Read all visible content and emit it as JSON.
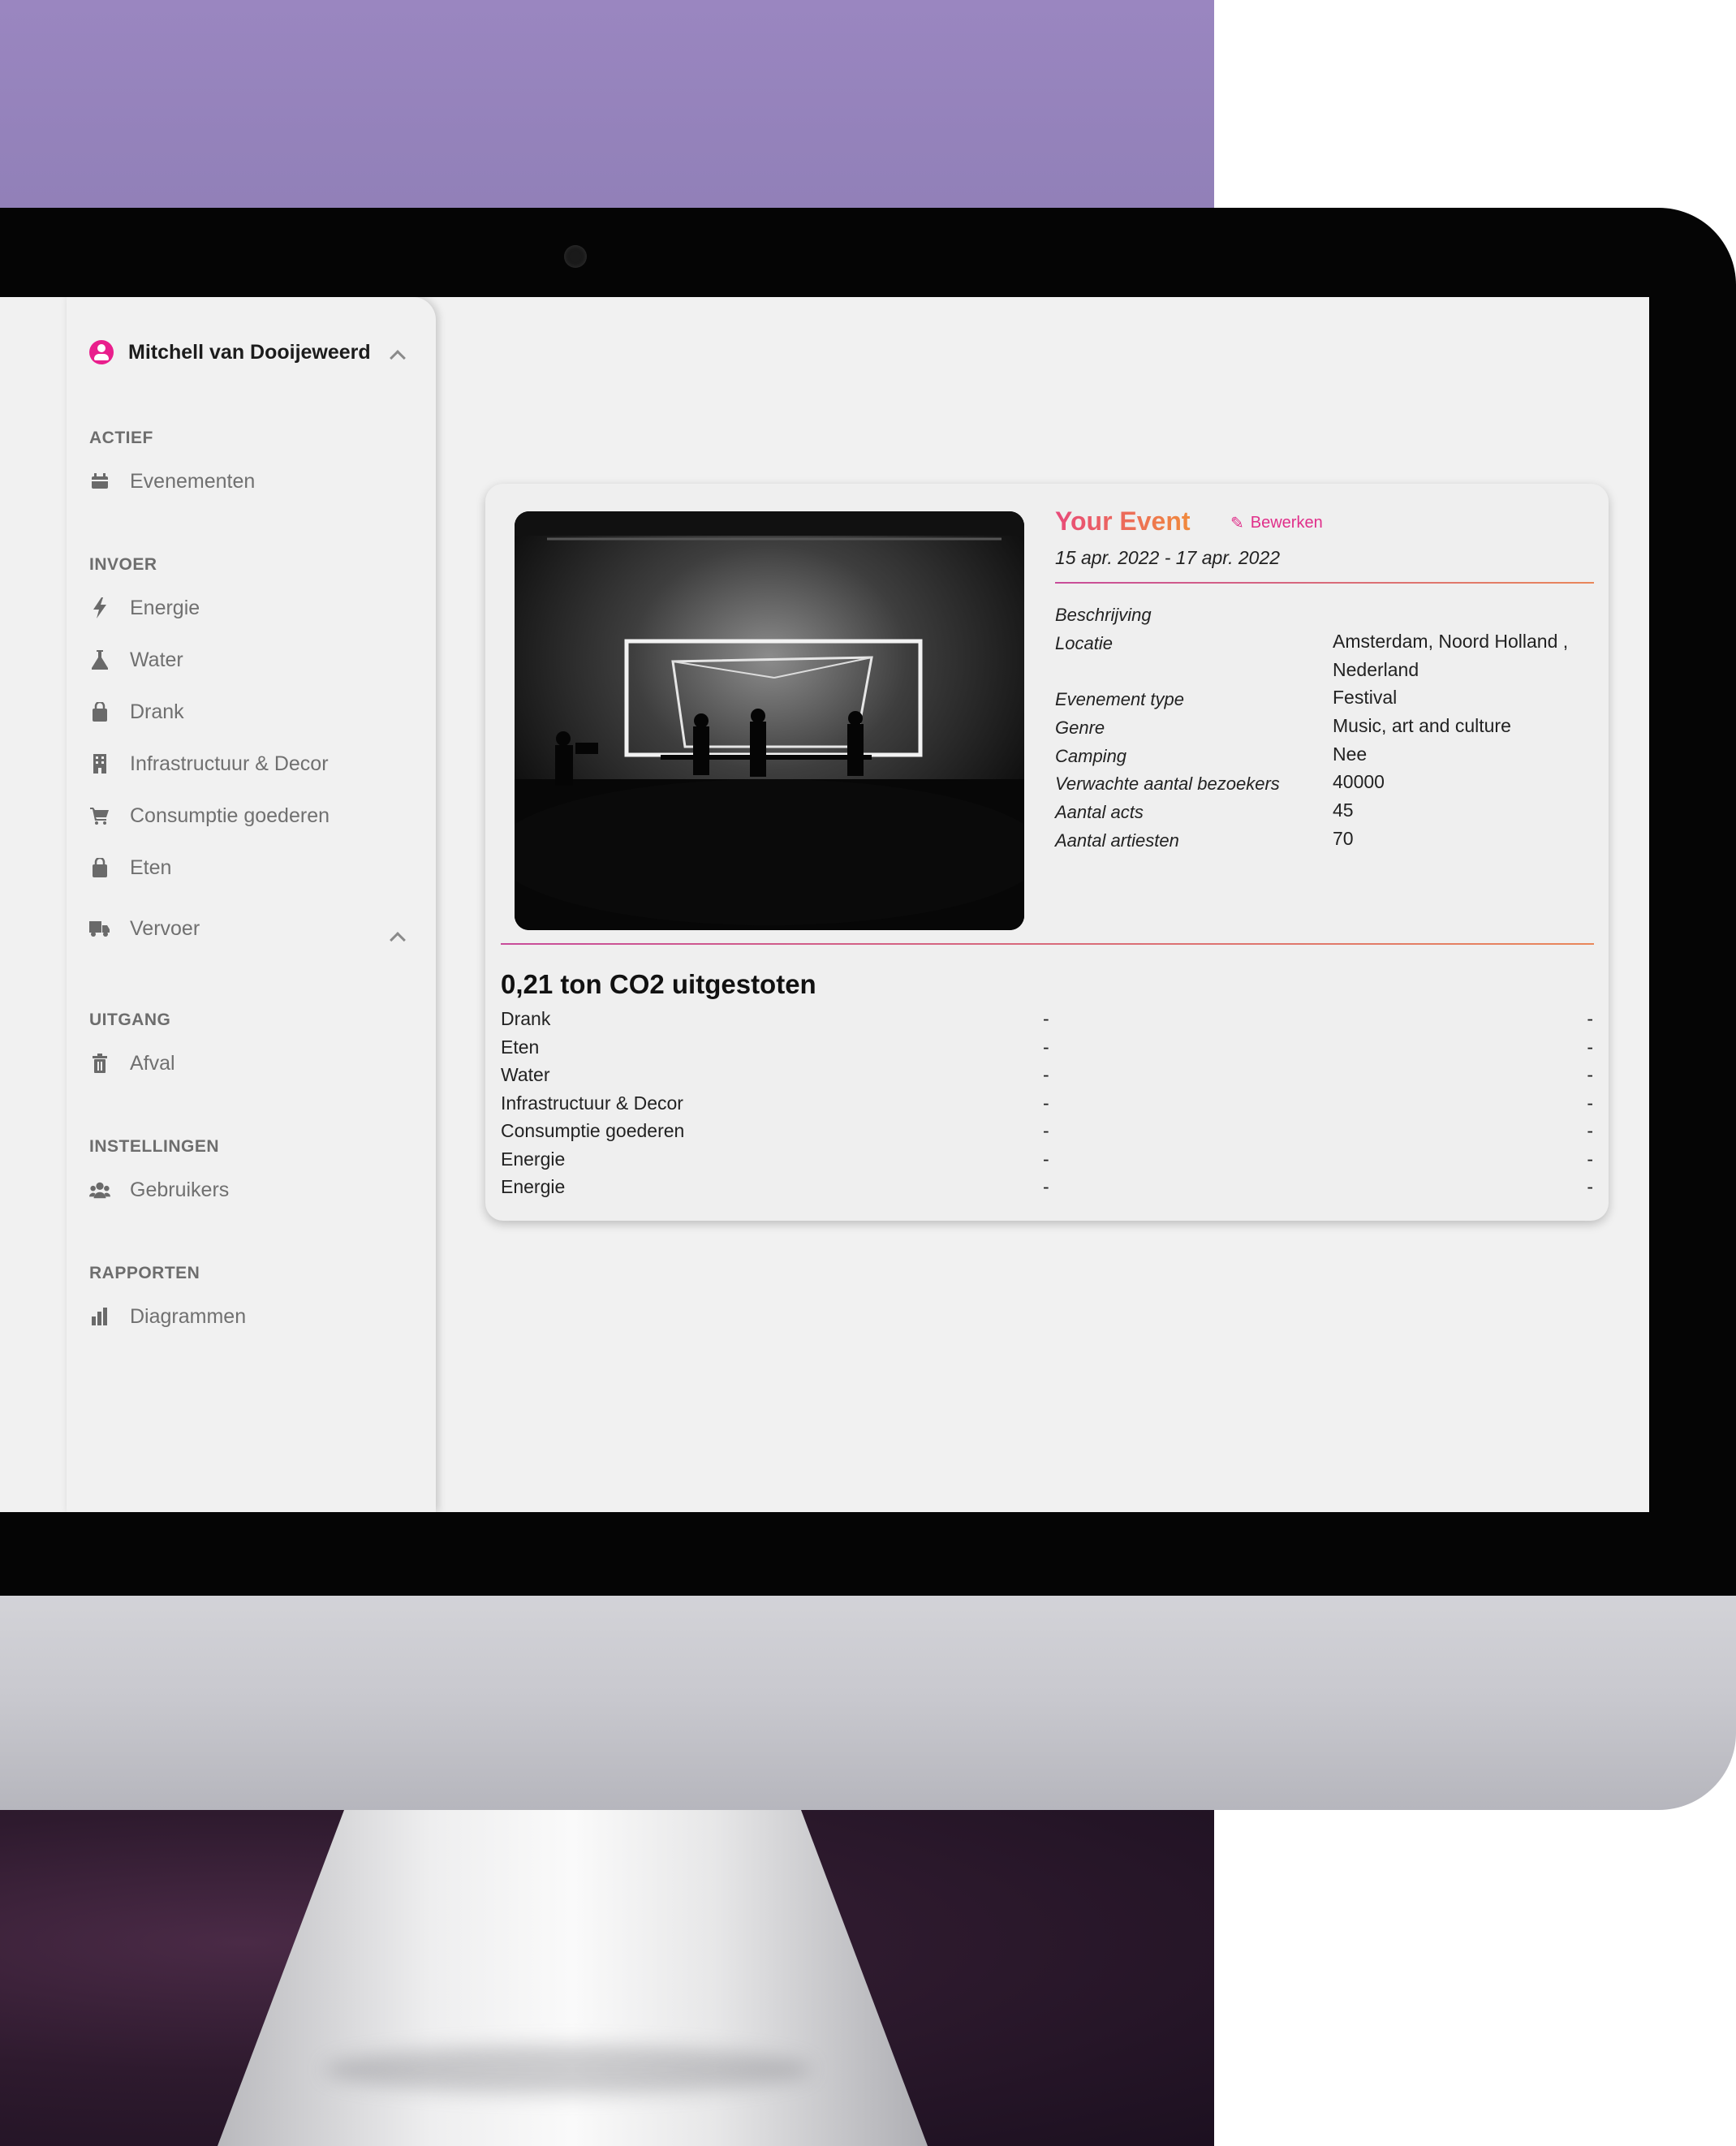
{
  "sidebar": {
    "user_name": "Mitchell van Dooijeweerd",
    "sections": {
      "actief": "ACTIEF",
      "invoer": "INVOER",
      "uitgang": "UITGANG",
      "instellingen": "INSTELLINGEN",
      "rapporten": "RAPPORTEN"
    },
    "items": {
      "evenementen": "Evenementen",
      "energie": "Energie",
      "water": "Water",
      "drank": "Drank",
      "infrastructuur": "Infrastructuur & Decor",
      "consumptie": "Consumptie goederen",
      "eten": "Eten",
      "vervoer": "Vervoer",
      "afval": "Afval",
      "gebruikers": "Gebruikers",
      "diagrammen": "Diagrammen"
    }
  },
  "event": {
    "title": "Your Event",
    "edit_label": "Bewerken",
    "dates": "15 apr. 2022 - 17 apr. 2022",
    "details": [
      {
        "label": "Beschrijving",
        "value": ""
      },
      {
        "label": "Locatie",
        "value": "Amsterdam, Noord Holland , Nederland"
      },
      {
        "label": "Evenement type",
        "value": "Festival"
      },
      {
        "label": "Genre",
        "value": "Music, art and culture"
      },
      {
        "label": "Camping",
        "value": "Nee"
      },
      {
        "label": "Verwachte aantal bezoekers",
        "value": "40000"
      },
      {
        "label": "Aantal acts",
        "value": "45"
      },
      {
        "label": "Aantal artiesten",
        "value": "70"
      }
    ]
  },
  "emissions": {
    "title": "0,21 ton CO2 uitgestoten",
    "rows": [
      {
        "name": "Drank",
        "a": "-",
        "b": "-"
      },
      {
        "name": "Eten",
        "a": "-",
        "b": "-"
      },
      {
        "name": "Water",
        "a": "-",
        "b": "-"
      },
      {
        "name": "Infrastructuur & Decor",
        "a": "-",
        "b": "-"
      },
      {
        "name": "Consumptie goederen",
        "a": "-",
        "b": "-"
      },
      {
        "name": "Energie",
        "a": "-",
        "b": "-"
      },
      {
        "name": "Energie",
        "a": "-",
        "b": "-"
      }
    ]
  },
  "colors": {
    "accent": "#e91e8c",
    "title_gradient_start": "#e84a7a",
    "title_gradient_end": "#f08a3c"
  }
}
